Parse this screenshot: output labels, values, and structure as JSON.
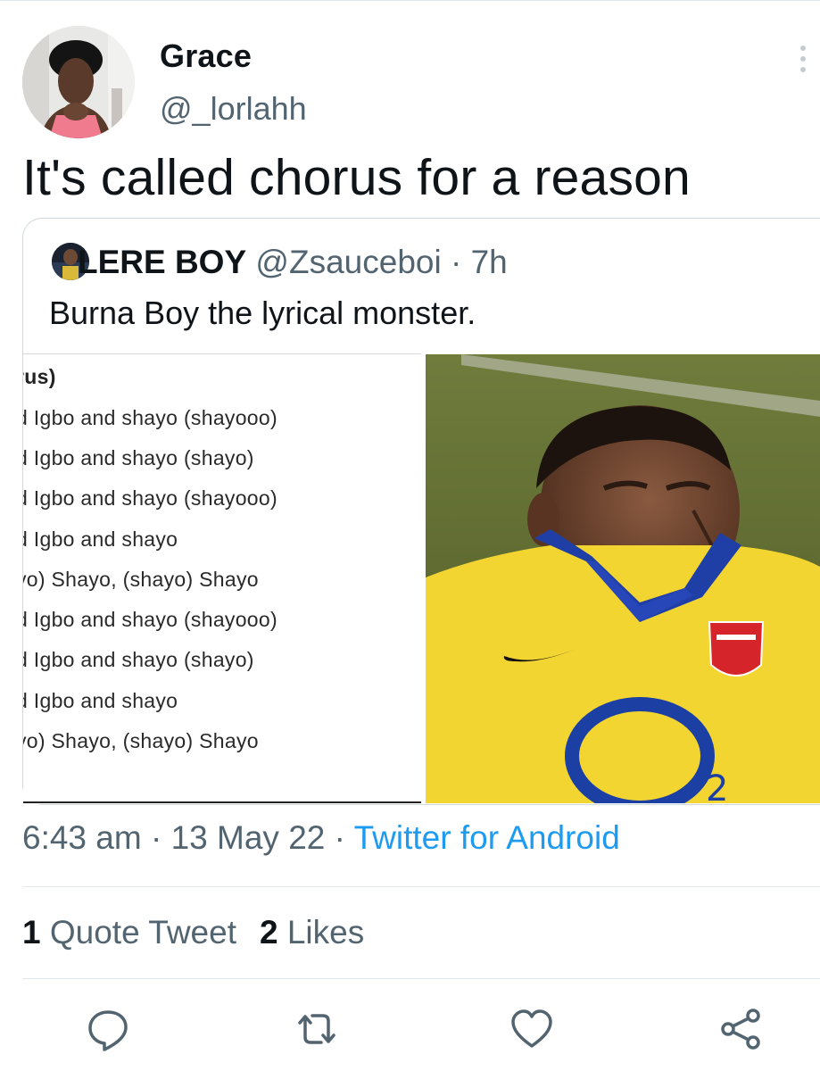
{
  "tweet": {
    "display_name": "Grace",
    "handle": "@_lorlahh",
    "text": "It's called chorus for a reason",
    "time": "6:43 am",
    "date": "13 May 22",
    "source": "Twitter for Android",
    "sep": "·"
  },
  "quoted_tweet": {
    "display_name": "LERE BOY",
    "handle": "@Zsauceboi",
    "age": "7h",
    "text": "Burna Boy the lyrical monster.",
    "lyrics": [
      "rus)",
      "d Igbo and shayo (shayooo)",
      "d Igbo and shayo (shayo)",
      "d Igbo and shayo (shayooo)",
      "d Igbo and shayo",
      "yo) Shayo, (shayo) Shayo",
      "d Igbo and shayo (shayooo)",
      "d Igbo and shayo (shayo)",
      "d Igbo and shayo",
      "yo) Shayo, (shayo) Shayo"
    ]
  },
  "stats": {
    "quote_count": "1",
    "quote_label": "Quote Tweet",
    "like_count": "2",
    "like_label": "Likes"
  },
  "actions": [
    "reply-icon",
    "retweet-icon",
    "like-icon",
    "share-icon"
  ],
  "colors": {
    "link": "#1d9bf0",
    "secondary": "#536471",
    "icon": "#536471",
    "jersey": "#f3d531",
    "collar": "#1f3fa6"
  }
}
